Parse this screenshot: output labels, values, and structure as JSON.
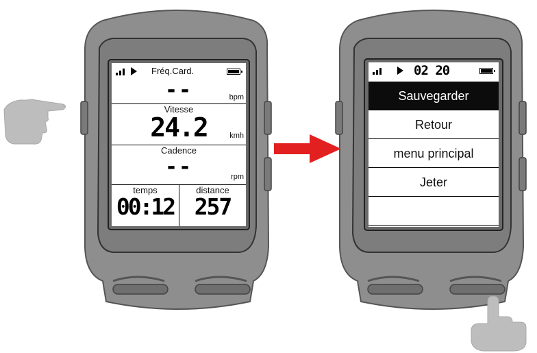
{
  "device_left": {
    "screen": {
      "status_title": "Fréq.Card.",
      "fields": {
        "heart_rate": {
          "value": "--",
          "unit": "bpm"
        },
        "speed": {
          "label": "Vitesse",
          "value": "24.2",
          "unit": "kmh"
        },
        "cadence": {
          "label": "Cadence",
          "value": "--",
          "unit": "rpm"
        },
        "time": {
          "label": "temps",
          "value": "00:12"
        },
        "distance": {
          "label": "distance",
          "value": "257"
        }
      }
    },
    "icons": [
      "signal-icon",
      "play-icon",
      "battery-icon"
    ]
  },
  "device_right": {
    "screen": {
      "clock": "02 20",
      "menu": [
        {
          "label": "Sauvegarder",
          "selected": true
        },
        {
          "label": "Retour",
          "selected": false
        },
        {
          "label": "menu principal",
          "selected": false
        },
        {
          "label": "Jeter",
          "selected": false
        },
        {
          "label": "",
          "selected": false
        }
      ]
    },
    "icons": [
      "signal-icon",
      "play-icon",
      "battery-icon"
    ]
  },
  "annotations": {
    "left_hand": "pointing-hand-icon",
    "arrow": "right-arrow",
    "right_hand": "pressing-hand-icon",
    "arrow_color": "#e32020",
    "device_body_color": "#8c8c8c",
    "hand_color": "#bdbdbd"
  }
}
